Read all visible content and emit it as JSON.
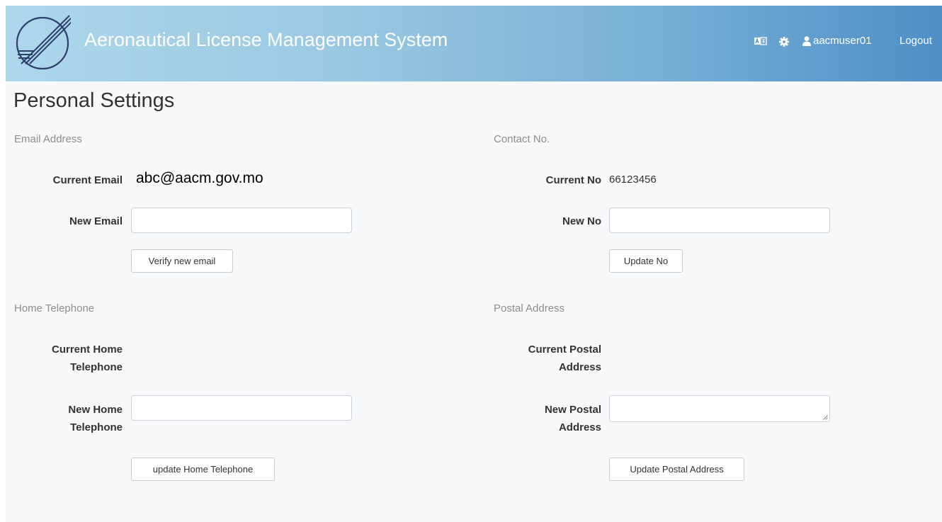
{
  "header": {
    "title": "Aeronautical License Management System",
    "username": "aacmuser01",
    "logout_label": "Logout"
  },
  "page": {
    "title": "Personal Settings"
  },
  "email": {
    "section_title": "Email Address",
    "current_label": "Current Email",
    "current_value": "abc@aacm.gov.mo",
    "new_label": "New Email",
    "new_value": "",
    "button_label": "Verify new email"
  },
  "contact": {
    "section_title": "Contact No.",
    "current_label": "Current No",
    "current_value": "66123456",
    "new_label": "New No",
    "new_value": "",
    "button_label": "Update No"
  },
  "home_phone": {
    "section_title": "Home Telephone",
    "current_label_line1": "Current Home",
    "current_label_line2": "Telephone",
    "current_value": "",
    "new_label_line1": "New Home",
    "new_label_line2": "Telephone",
    "new_value": "",
    "button_label": "update Home Telephone"
  },
  "postal": {
    "section_title": "Postal Address",
    "current_label_line1": "Current Postal",
    "current_label_line2": "Address",
    "current_value": "",
    "new_label_line1": "New Postal",
    "new_label_line2": "Address",
    "new_value": "",
    "button_label": "Update Postal Address"
  },
  "icons": {
    "logo": "aircraft-wing-logo",
    "language": "language-switch-icon",
    "settings": "gear-icon",
    "user": "user-icon"
  },
  "colors": {
    "header_gradient_start": "#aed7ea",
    "header_gradient_end": "#4f8fc6",
    "page_background": "#f7f8fa",
    "section_title": "#8e8e8e"
  }
}
